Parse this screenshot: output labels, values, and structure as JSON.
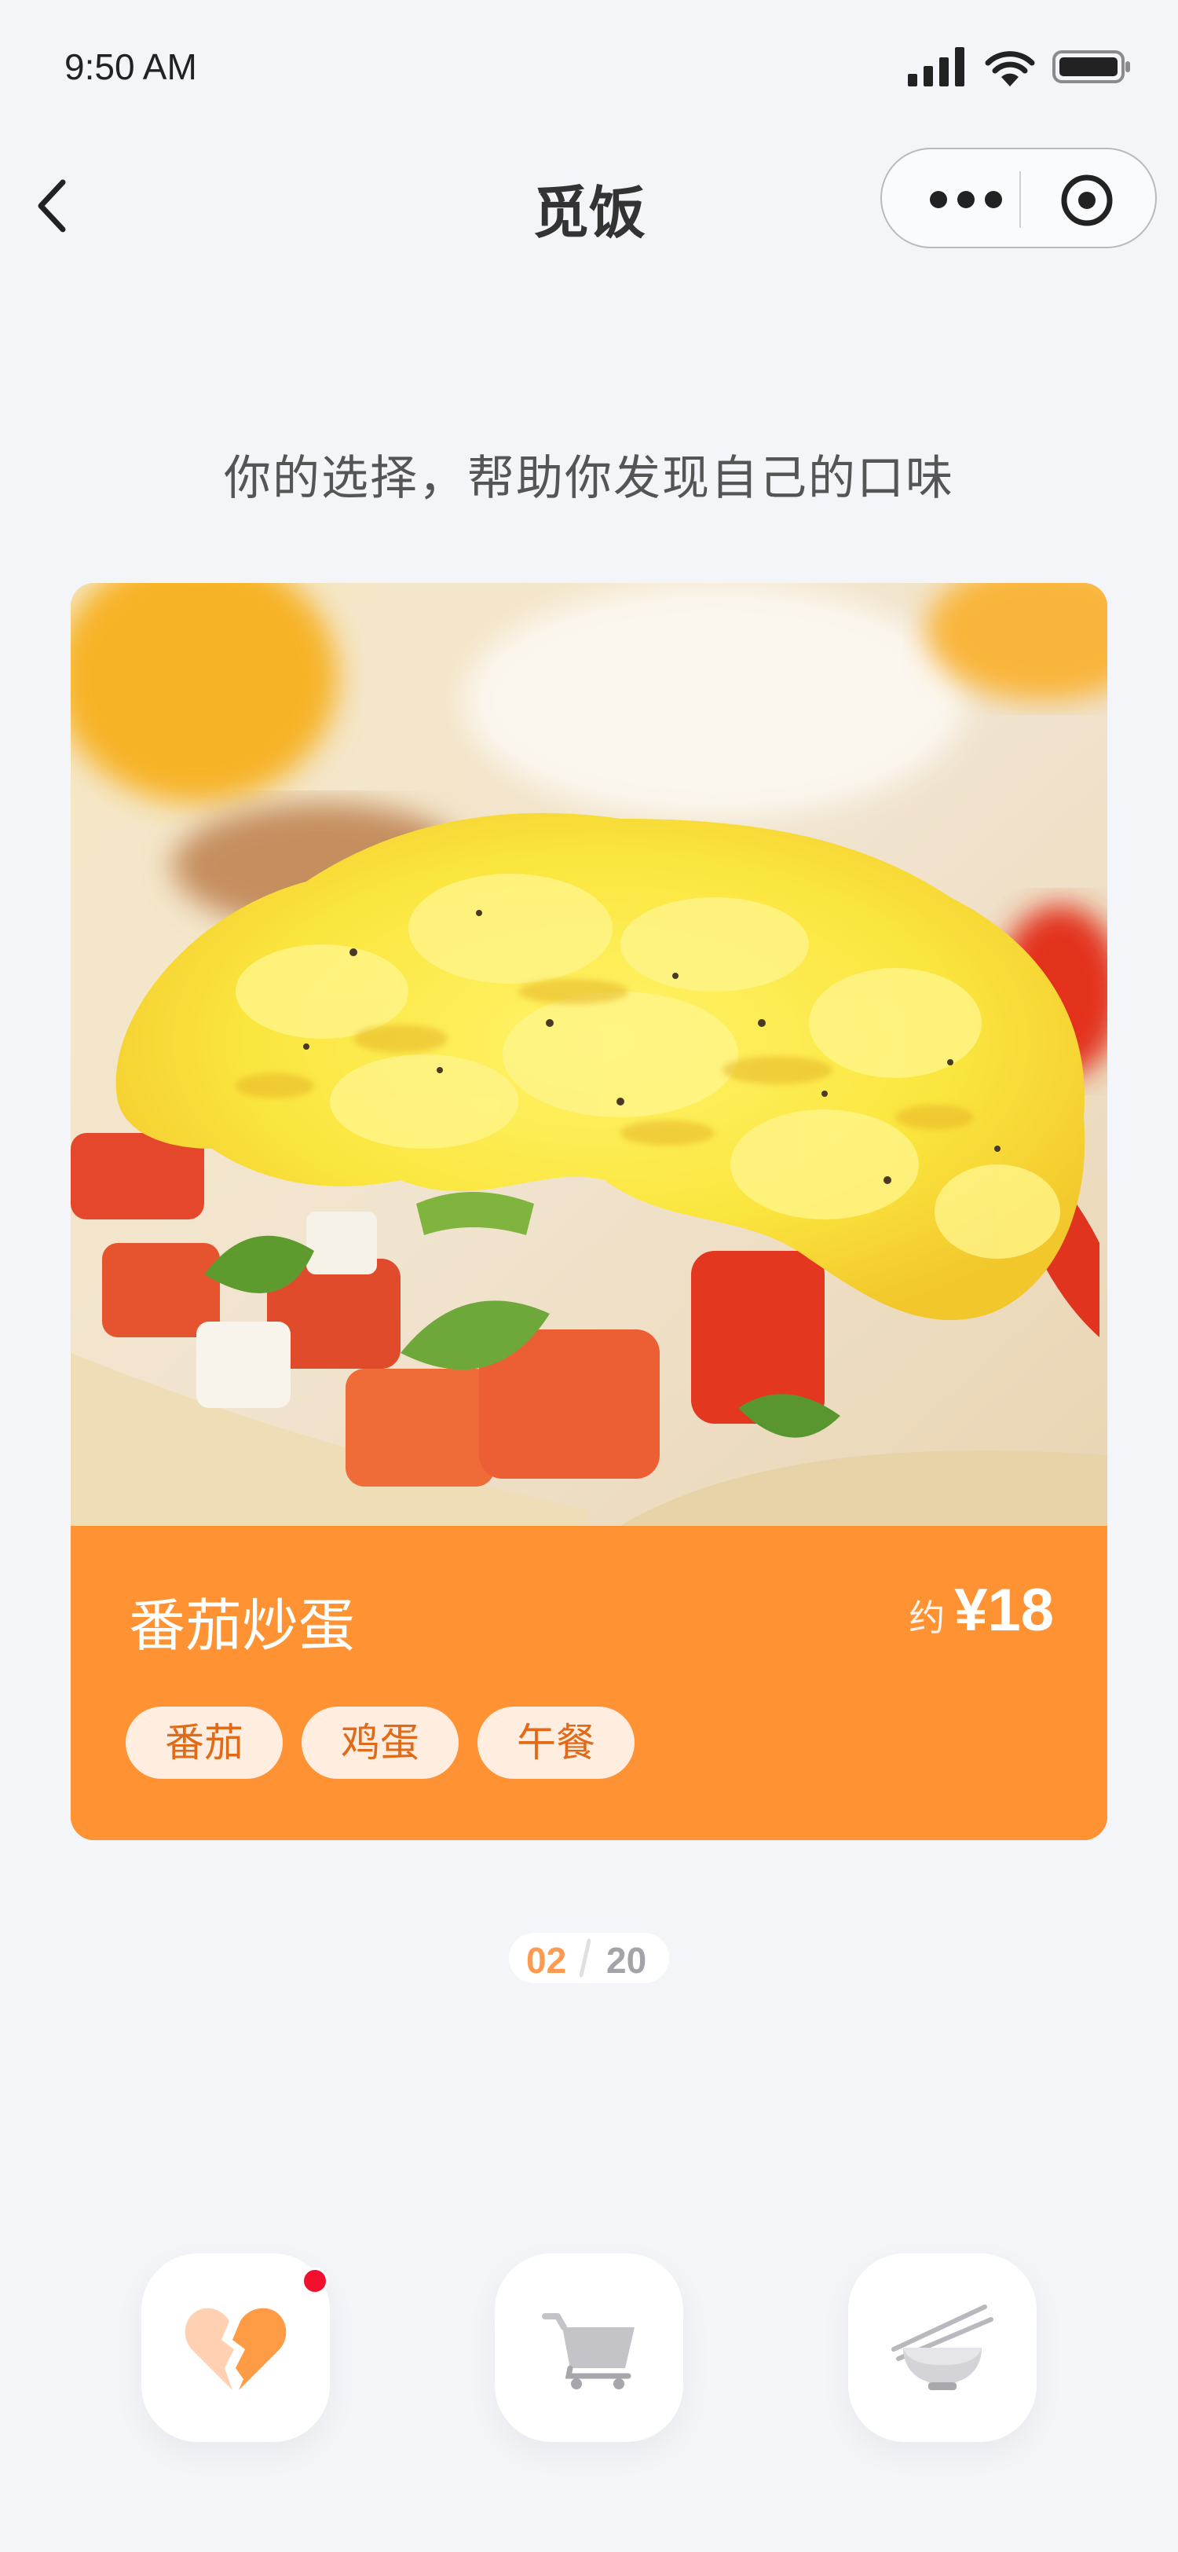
{
  "status_bar": {
    "time": "9:50 AM"
  },
  "nav": {
    "title": "觅饭"
  },
  "subtitle": "你的选择，帮助你发现自己的口味",
  "dish": {
    "name": "番茄炒蛋",
    "price_prefix": "约",
    "price": "¥18",
    "tags": [
      "番茄",
      "鸡蛋",
      "午餐"
    ]
  },
  "pager": {
    "current": "02",
    "total": "20"
  },
  "actions": {
    "dislike_icon": "broken-heart-icon",
    "cart_icon": "cart-icon",
    "bowl_icon": "bowl-chopsticks-icon",
    "has_notification": true
  },
  "colors": {
    "accent": "#FF9233",
    "tag_bg": "#FFEEE0",
    "tag_text": "#E06A18",
    "badge": "#F2102E",
    "background": "#F4F5F9"
  }
}
